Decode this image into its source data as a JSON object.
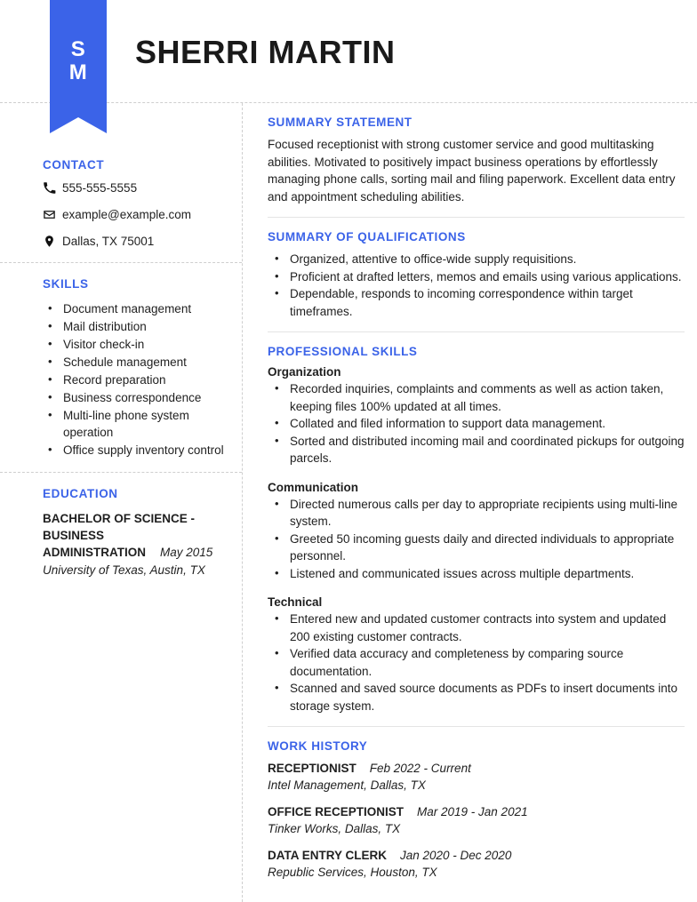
{
  "theme": {
    "accent": "#3b63e8",
    "text": "#1f1f1f",
    "name_color": "#1a1a1a"
  },
  "header": {
    "monogram_first": "S",
    "monogram_last": "M",
    "name": "SHERRI MARTIN"
  },
  "contact": {
    "heading": "CONTACT",
    "phone": "555-555-5555",
    "email": "example@example.com",
    "location": "Dallas, TX 75001"
  },
  "skills": {
    "heading": "SKILLS",
    "items": [
      "Document management",
      "Mail distribution",
      "Visitor check-in",
      "Schedule management",
      "Record preparation",
      "Business correspondence",
      "Multi-line phone system operation",
      "Office supply inventory control"
    ]
  },
  "education": {
    "heading": "EDUCATION",
    "degree": "BACHELOR OF SCIENCE - BUSINESS ADMINISTRATION",
    "date": "May 2015",
    "school": "University of Texas, Austin, TX"
  },
  "summary": {
    "heading": "SUMMARY STATEMENT",
    "text": "Focused receptionist with strong customer service and good multitasking abilities. Motivated to positively impact business operations by effortlessly managing phone calls, sorting mail and filing paperwork. Excellent data entry and appointment scheduling abilities."
  },
  "qualifications": {
    "heading": "SUMMARY OF QUALIFICATIONS",
    "items": [
      "Organized, attentive to office-wide supply requisitions.",
      "Proficient at drafted letters, memos and emails using various applications.",
      "Dependable, responds to incoming correspondence within target timeframes."
    ]
  },
  "professional_skills": {
    "heading": "PROFESSIONAL SKILLS",
    "groups": [
      {
        "name": "Organization",
        "items": [
          "Recorded inquiries, complaints and comments as well as action taken, keeping files 100% updated at all times.",
          "Collated and filed information to support data management.",
          "Sorted and distributed incoming mail and coordinated pickups for outgoing parcels."
        ]
      },
      {
        "name": "Communication",
        "items": [
          "Directed numerous calls per day to appropriate recipients using multi-line system.",
          "Greeted 50 incoming guests daily and directed individuals to appropriate personnel.",
          "Listened and communicated issues across multiple departments."
        ]
      },
      {
        "name": "Technical",
        "items": [
          "Entered new and updated customer contracts into system and updated 200 existing customer contracts.",
          "Verified data accuracy and completeness by comparing source documentation.",
          "Scanned and saved source documents as PDFs to insert documents into storage system."
        ]
      }
    ]
  },
  "work_history": {
    "heading": "WORK HISTORY",
    "jobs": [
      {
        "title": "RECEPTIONIST",
        "dates": "Feb 2022 - Current",
        "company": "Intel Management, Dallas, TX"
      },
      {
        "title": "OFFICE RECEPTIONIST",
        "dates": "Mar 2019 - Jan 2021",
        "company": "Tinker Works, Dallas, TX"
      },
      {
        "title": "DATA ENTRY CLERK",
        "dates": "Jan 2020 - Dec 2020",
        "company": "Republic Services, Houston, TX"
      }
    ]
  }
}
